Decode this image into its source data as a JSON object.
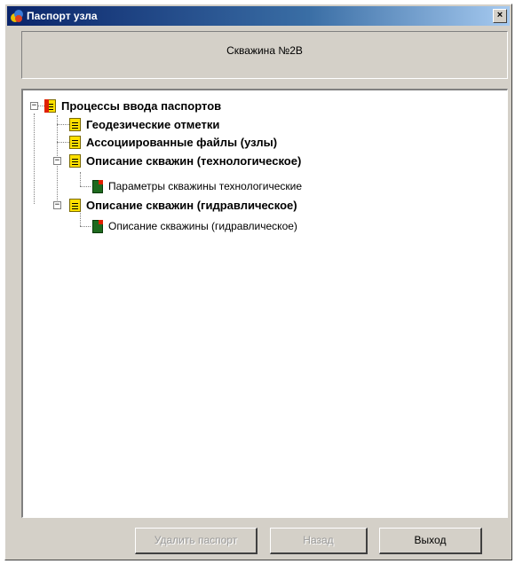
{
  "window": {
    "title": "Паспорт узла",
    "close_glyph": "×"
  },
  "header": {
    "text": "Скважина №2В"
  },
  "tree": {
    "root": {
      "label": "Процессы ввода паспортов",
      "icon": "document-icon"
    },
    "items": [
      {
        "label": "Геодезические отметки",
        "icon": "document-icon"
      },
      {
        "label": "Ассоциированные файлы (узлы)",
        "icon": "document-icon"
      },
      {
        "label": "Описание скважин (технологическое)",
        "icon": "document-icon"
      },
      {
        "label": "Параметры скважины технологические",
        "icon": "form-icon"
      },
      {
        "label": "Описание скважин (гидравлическое)",
        "icon": "document-icon"
      },
      {
        "label": "Описание скважины (гидравлическое)",
        "icon": "form-icon"
      }
    ],
    "expander_glyph": "−"
  },
  "buttons": {
    "delete": {
      "label": "Удалить паспорт",
      "enabled": false
    },
    "back": {
      "label": "Назад",
      "enabled": false
    },
    "exit": {
      "label": "Выход",
      "enabled": true
    }
  },
  "colors": {
    "titlebar_start": "#0a246a",
    "titlebar_end": "#a6caf0",
    "face": "#d4d0c8",
    "icon_yellow": "#ffe000",
    "icon_red": "#e02000",
    "icon_green": "#1e6a1e"
  }
}
